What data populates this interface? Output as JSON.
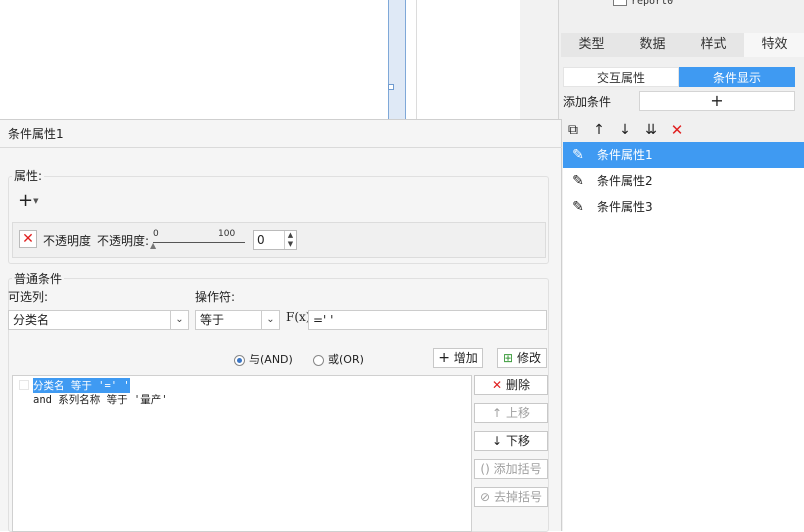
{
  "tree": {
    "item": "report0"
  },
  "right_panel": {
    "tabs": [
      "类型",
      "数据",
      "样式",
      "特效"
    ],
    "active_tab": "特效",
    "subtabs": [
      "交互属性",
      "条件显示"
    ],
    "active_subtab": "条件显示",
    "add_condition_label": "添加条件",
    "add_condition_button": "+",
    "toolbar_icons": [
      "copy-icon",
      "move-up-icon",
      "move-down-icon",
      "move-bottom-icon",
      "delete-icon"
    ],
    "conditions": [
      "条件属性1",
      "条件属性2",
      "条件属性3"
    ],
    "selected_condition": "条件属性1"
  },
  "dialog": {
    "title": "条件属性1",
    "attr_group_label": "属性:",
    "add_attr_button": "+",
    "opacity": {
      "name": "不透明度",
      "label": "不透明度:",
      "slider_min_label": "0",
      "slider_max_label": "100",
      "value": "0"
    },
    "common_cond_label": "普通条件",
    "col_label": "可选列:",
    "col_value": "分类名",
    "op_label": "操作符:",
    "op_value": "等于",
    "fx_label": "F(x)",
    "formula_value": "=' '",
    "logic": {
      "and_label": "与(AND)",
      "or_label": "或(OR)",
      "selected": "and"
    },
    "buttons": {
      "add": "增加",
      "modify": "修改",
      "delete": "删除",
      "move_up": "上移",
      "move_down": "下移",
      "add_paren": "添加括号",
      "remove_paren": "去掉括号"
    },
    "expressions": [
      "分类名 等于 '=' '",
      "and 系列名称 等于 '量产'"
    ],
    "accent": "#3f9af2"
  }
}
